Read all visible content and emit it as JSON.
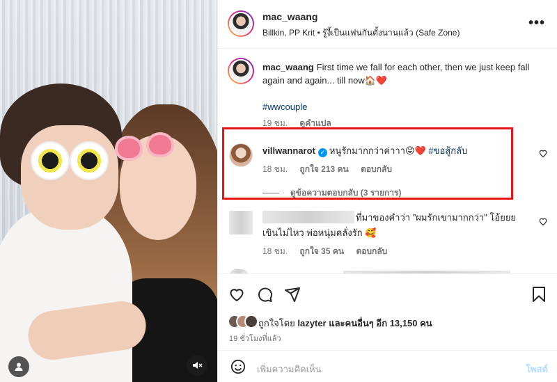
{
  "post": {
    "username": "mac_waang",
    "subtitle": "Billkin, PP Krit • รู้งี้เป็นแฟนกันตั้งนานแล้ว (Safe Zone)",
    "more_label": "•••"
  },
  "caption": {
    "username": "mac_waang",
    "text": "First time we fall for each other, then we just keep fall again and again... till now🏠❤️",
    "hashtag": "#wwcouple",
    "time": "19 ชม.",
    "translate": "ดูคำแปล"
  },
  "comments": [
    {
      "username": "villwannarot",
      "text": "หนูรักมากกว่าค่าาา😝❤️",
      "hashtag": "#ขอสู้กลับ",
      "time": "18 ชม.",
      "likes": "ถูกใจ 213 คน",
      "reply": "ตอบกลับ",
      "view_replies": "ดูข้อความตอบกลับ (3 รายการ)"
    },
    {
      "text_line1": "ที่มาของคำว่า \"ผมรักเขามากกว่า\" โอ้ยยย",
      "text_line2": "เขินไม่ไหว พ่อหนุ่มคลั่งรัก 🥰",
      "time": "18 ชม.",
      "likes": "ถูกใจ 35 คน",
      "reply": "ตอบกลับ"
    }
  ],
  "liked_by": {
    "prefix": "ถูกใจโดย",
    "user": "lazyter",
    "and": "และคนอื่นๆ อีก 13,150 คน"
  },
  "posted_time": "19 ชั่วโมงที่แล้ว",
  "add_comment": {
    "placeholder": "เพิ่มความคิดเห็น",
    "post_label": "โพสต์"
  },
  "icons": {
    "like": "heart-icon",
    "comment": "comment-bubble-icon",
    "share": "paper-plane-icon",
    "save": "bookmark-icon",
    "emoji": "emoji-icon",
    "tags": "user-tag-icon",
    "mute": "muted-speaker-icon"
  },
  "colors": {
    "highlight_box": "#e8141c",
    "hashtag": "#00376b",
    "verified": "#0095f6",
    "muted_text": "#737373"
  }
}
